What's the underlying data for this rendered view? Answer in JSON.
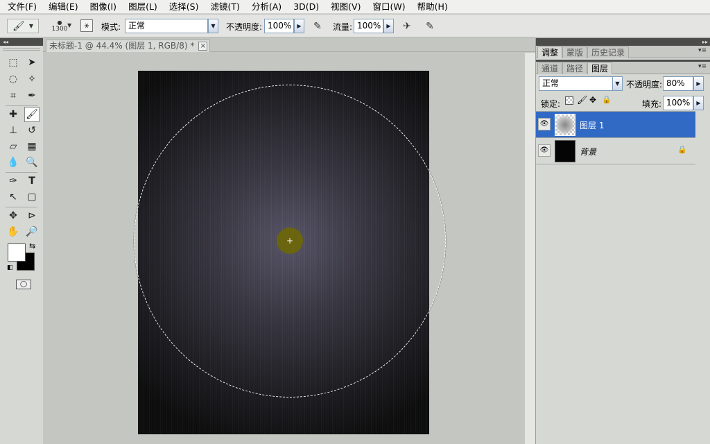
{
  "menu": [
    "文件(F)",
    "编辑(E)",
    "图像(I)",
    "图层(L)",
    "选择(S)",
    "滤镜(T)",
    "分析(A)",
    "3D(D)",
    "视图(V)",
    "窗口(W)",
    "帮助(H)"
  ],
  "options": {
    "brush_size": "1300",
    "mode_label": "模式:",
    "mode_value": "正常",
    "opacity_label": "不透明度:",
    "opacity_value": "100%",
    "flow_label": "流量:",
    "flow_value": "100%"
  },
  "document": {
    "tab_title": "未标题-1 @ 44.4% (图层 1, RGB/8) *",
    "close_glyph": "×"
  },
  "panels": {
    "top_tabs": [
      "调整",
      "蒙版",
      "历史记录"
    ],
    "layer_tabs": [
      "通道",
      "路径",
      "图层"
    ],
    "blend_mode": "正常",
    "opacity_label": "不透明度:",
    "opacity_value": "80%",
    "lock_label": "锁定:",
    "fill_label": "填充:",
    "fill_value": "100%",
    "layers": [
      {
        "name": "图层 1",
        "selected": true
      },
      {
        "name": "背景",
        "selected": false,
        "locked": true
      }
    ]
  },
  "colors": {
    "selection_highlight": "#316ac5",
    "foreground": "#ffffff",
    "background": "#000000"
  }
}
